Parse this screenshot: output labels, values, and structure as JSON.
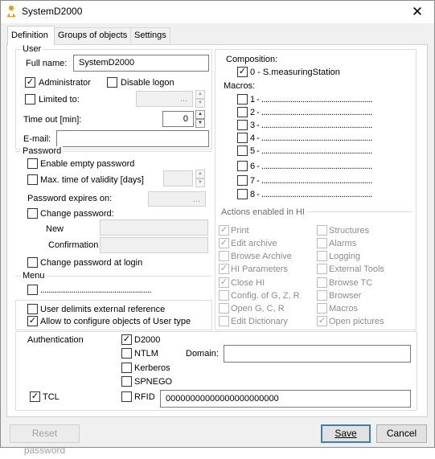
{
  "window": {
    "title": "SystemD2000",
    "close_glyph": "✕"
  },
  "tabs": [
    {
      "label": "Definition"
    },
    {
      "label": "Groups of objects"
    },
    {
      "label": "Settings"
    }
  ],
  "user": {
    "group_label": "User",
    "full_name_label": "Full name:",
    "full_name_value": "SystemD2000",
    "administrator_label": "Administrator",
    "administrator_checked": true,
    "disable_logon_label": "Disable logon",
    "limited_to_label": "Limited to:",
    "limited_to_button": "...",
    "timeout_label": "Time out [min]:",
    "timeout_value": "0",
    "email_label": "E-mail:",
    "email_value": ""
  },
  "password": {
    "group_label": "Password",
    "enable_empty_label": "Enable empty password",
    "max_validity_label": "Max. time of validity [days]",
    "expires_on_label": "Password expires on:",
    "expires_button": "...",
    "change_password_label": "Change password:",
    "new_label": "New",
    "confirmation_label": "Confirmation",
    "change_at_login_label": "Change password at login"
  },
  "menu": {
    "group_label": "Menu",
    "menu_value": "......................................................"
  },
  "options": {
    "user_delimits_label": "User delimits external reference",
    "allow_configure_label": "Allow to configure objects of User type",
    "allow_configure_checked": true
  },
  "composition": {
    "label": "Composition:",
    "item_label": "0 - S.measuringStation",
    "item_checked": true
  },
  "macros": {
    "label": "Macros:",
    "items": [
      {
        "label": "1 - ......................................................"
      },
      {
        "label": "2 - ......................................................"
      },
      {
        "label": "3 - ......................................................"
      },
      {
        "label": "4 - ......................................................"
      },
      {
        "label": "5 - ......................................................"
      },
      {
        "label": "6 - ......................................................"
      },
      {
        "label": "7 - ......................................................"
      },
      {
        "label": "8 - ......................................................"
      }
    ]
  },
  "actions": {
    "label": "Actions enabled in HI",
    "left": [
      {
        "label": "Print",
        "checked": true
      },
      {
        "label": "Edit archive",
        "checked": true
      },
      {
        "label": "Browse Archive",
        "checked": false
      },
      {
        "label": "HI Parameters",
        "checked": true
      },
      {
        "label": "Close HI",
        "checked": true
      },
      {
        "label": "Config. of G, Z, R",
        "checked": false
      },
      {
        "label": "Open G, C, R",
        "checked": false
      },
      {
        "label": "Edit Dictionary",
        "checked": false
      }
    ],
    "right": [
      {
        "label": "Structures",
        "checked": false
      },
      {
        "label": "Alarms",
        "checked": false
      },
      {
        "label": "Logging",
        "checked": false
      },
      {
        "label": "External Tools",
        "checked": false
      },
      {
        "label": "Browse TC",
        "checked": false
      },
      {
        "label": "Browser",
        "checked": false
      },
      {
        "label": "Macros",
        "checked": false
      },
      {
        "label": "Open pictures",
        "checked": true
      }
    ]
  },
  "authentication": {
    "label": "Authentication",
    "d2000_label": "D2000",
    "d2000_checked": true,
    "ntlm_label": "NTLM",
    "kerberos_label": "Kerberos",
    "spnego_label": "SPNEGO",
    "rfid_label": "RFID",
    "rfid_value": "00000000000000000000000",
    "tcl_label": "TCL",
    "tcl_checked": true,
    "domain_label": "Domain:",
    "domain_value": ""
  },
  "buttons": {
    "reset_password": "Reset password",
    "save": "Save",
    "cancel": "Cancel"
  }
}
